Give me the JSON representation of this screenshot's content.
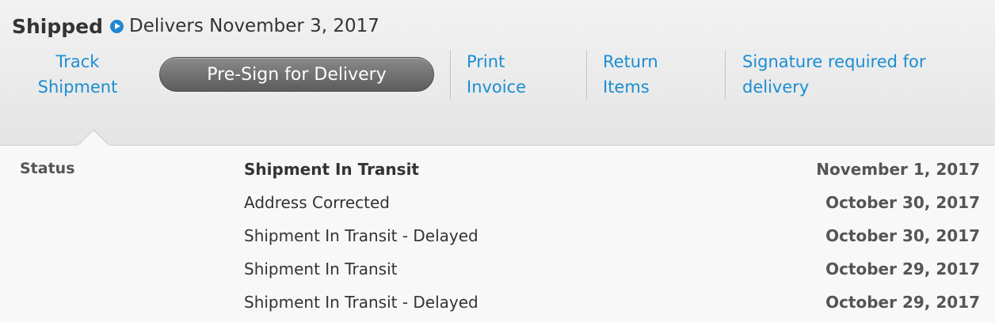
{
  "header": {
    "status": "Shipped",
    "delivery": "Delivers November 3, 2017"
  },
  "actions": {
    "track_line1": "Track",
    "track_line2": "Shipment",
    "presign": "Pre-Sign for Delivery",
    "print_line1": "Print",
    "print_line2": "Invoice",
    "return_line1": "Return",
    "return_line2": "Items",
    "signature_line1": "Signature required for",
    "signature_line2": "delivery"
  },
  "tracking": {
    "label": "Status",
    "events": [
      {
        "status": "Shipment In Transit",
        "date": "November 1, 2017"
      },
      {
        "status": "Address Corrected",
        "date": "October 30, 2017"
      },
      {
        "status": "Shipment In Transit - Delayed",
        "date": "October 30, 2017"
      },
      {
        "status": "Shipment In Transit",
        "date": "October 29, 2017"
      },
      {
        "status": "Shipment In Transit - Delayed",
        "date": "October 29, 2017"
      }
    ]
  },
  "colors": {
    "link": "#1a8ed2",
    "accent_icon": "#1f88d0",
    "button": "#6e6e6e"
  }
}
